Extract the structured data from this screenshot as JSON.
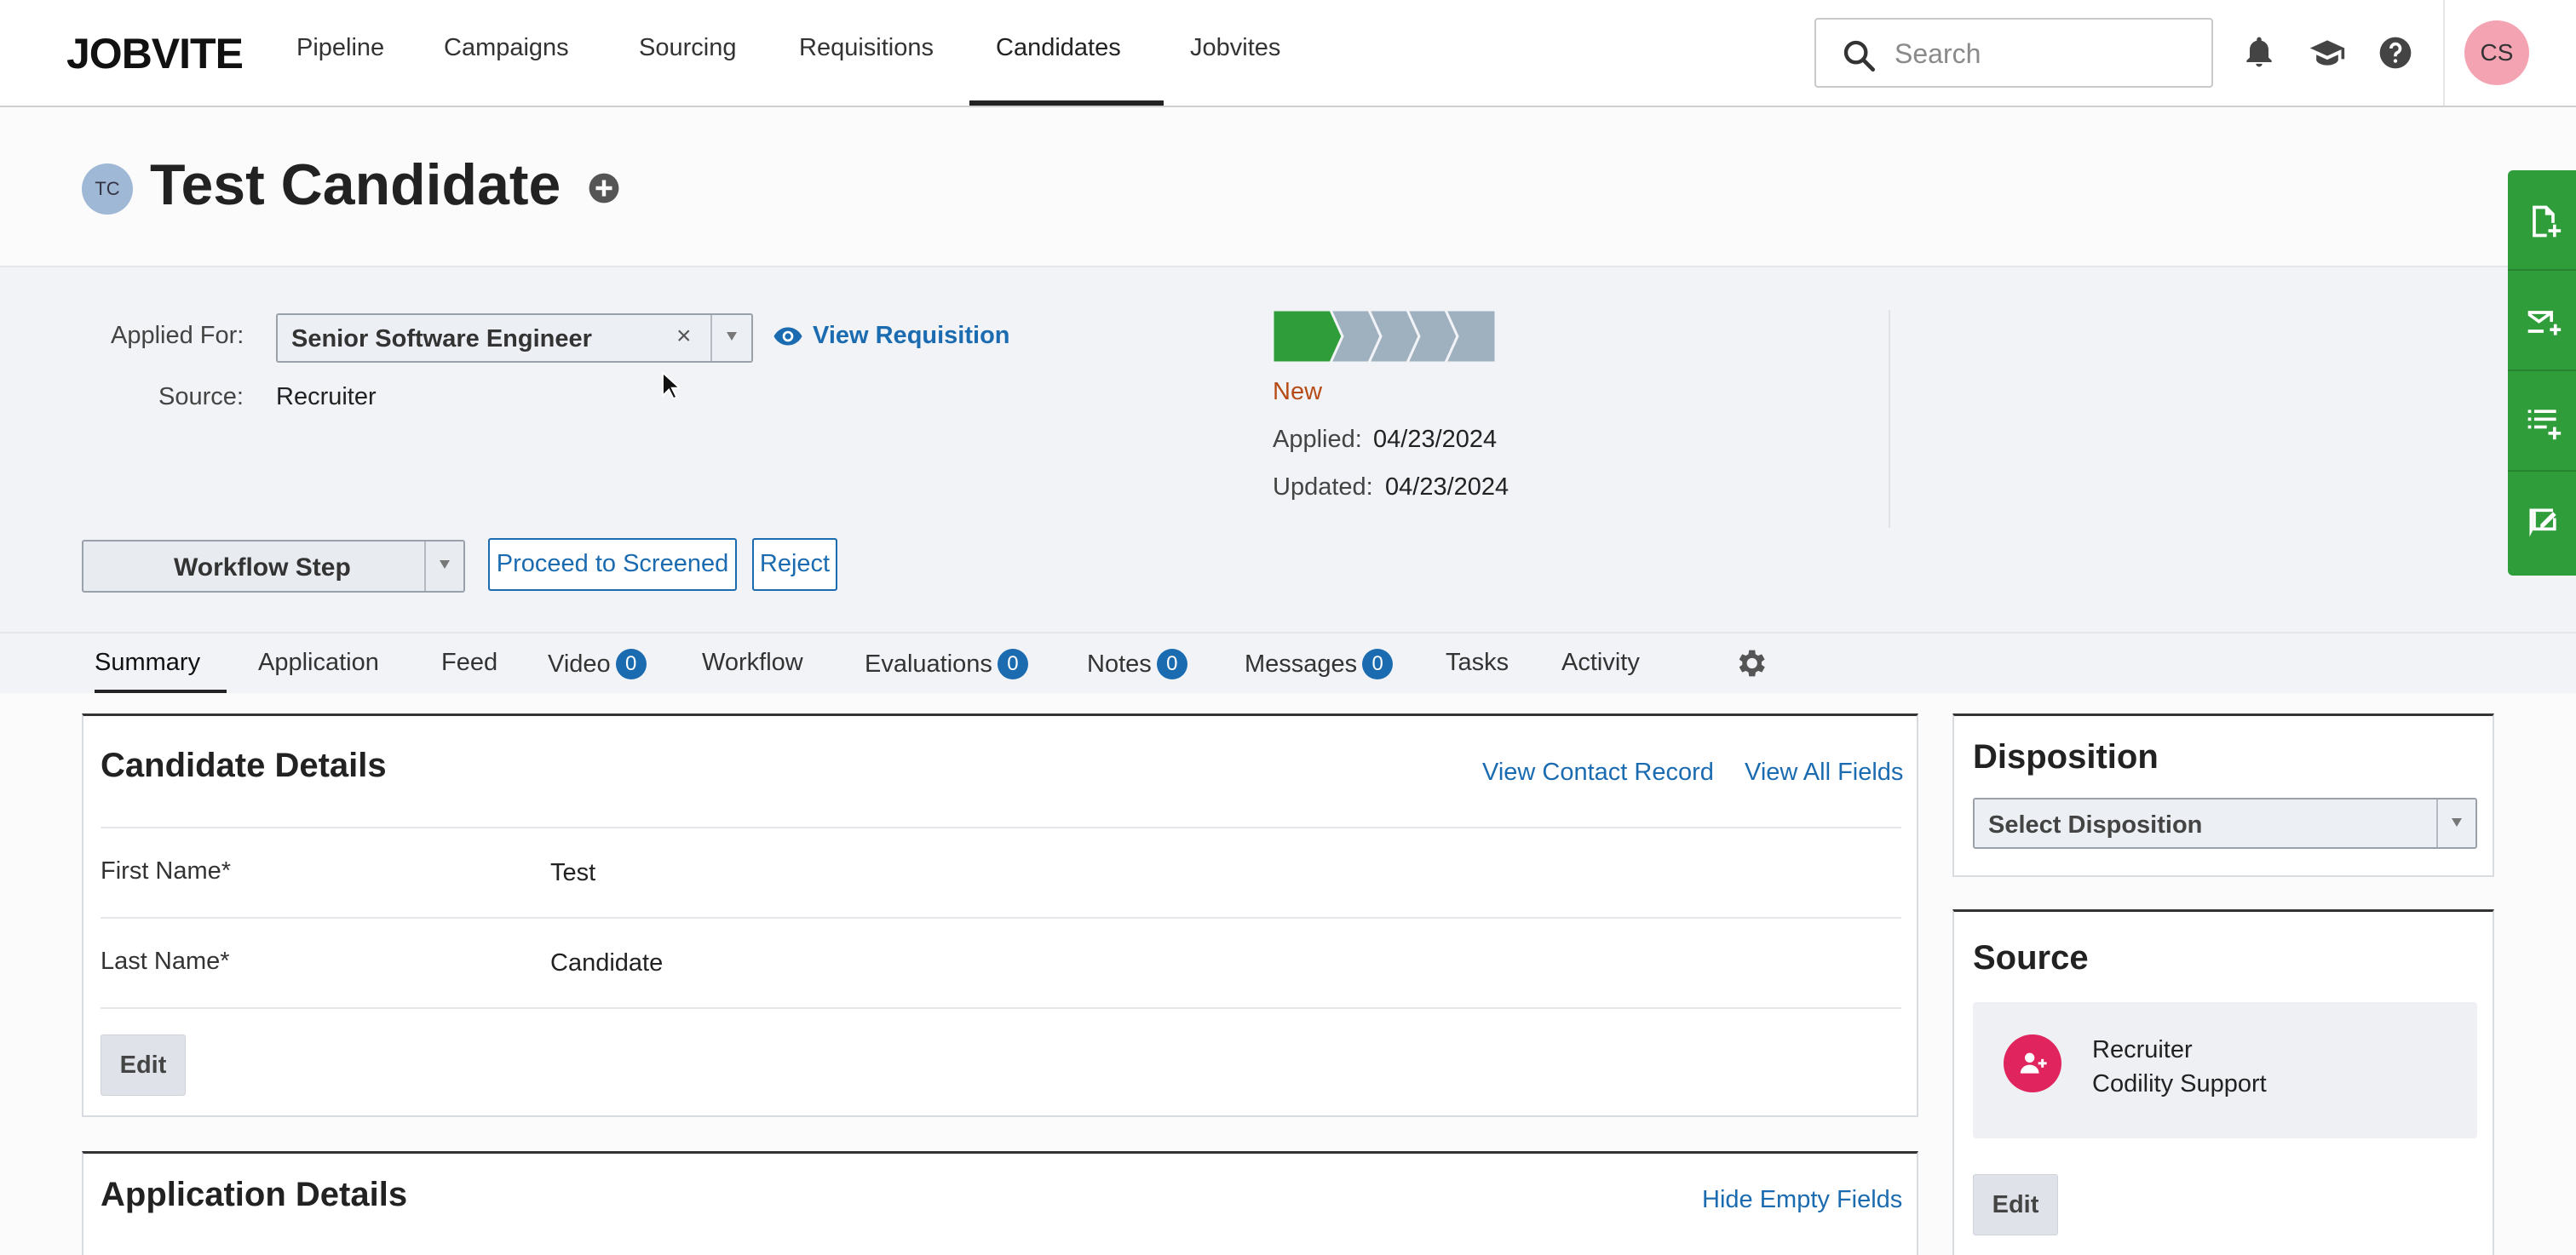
{
  "nav": {
    "logo": "JOBVITE",
    "items": [
      "Pipeline",
      "Campaigns",
      "Sourcing",
      "Requisitions",
      "Candidates",
      "Jobvites"
    ],
    "active": "Candidates",
    "search_placeholder": "Search",
    "user_initials": "CS"
  },
  "candidate": {
    "initials": "TC",
    "name": "Test Candidate"
  },
  "info": {
    "applied_for_label": "Applied For:",
    "applied_for_value": "Senior Software Engineer",
    "clear_symbol": "×",
    "view_requisition": "View Requisition",
    "source_label": "Source:",
    "source_value": "Recruiter",
    "status": "New",
    "status_color": "#b64b15",
    "progress_steps_total": 5,
    "progress_steps_done": 1,
    "applied_label": "Applied:",
    "applied_date": "04/23/2024",
    "updated_label": "Updated:",
    "updated_date": "04/23/2024",
    "workflow_step": "Workflow Step",
    "proceed_button": "Proceed to Screened",
    "reject_button": "Reject"
  },
  "tabs": [
    {
      "label": "Summary"
    },
    {
      "label": "Application"
    },
    {
      "label": "Feed"
    },
    {
      "label": "Video",
      "badge": "0"
    },
    {
      "label": "Workflow"
    },
    {
      "label": "Evaluations",
      "badge": "0"
    },
    {
      "label": "Notes",
      "badge": "0"
    },
    {
      "label": "Messages",
      "badge": "0"
    },
    {
      "label": "Tasks"
    },
    {
      "label": "Activity"
    }
  ],
  "candidate_details": {
    "title": "Candidate Details",
    "view_contact_record": "View Contact Record",
    "view_all_fields": "View All Fields",
    "fields": [
      {
        "label": "First Name",
        "required": "*",
        "value": "Test"
      },
      {
        "label": "Last Name",
        "required": "*",
        "value": "Candidate"
      }
    ],
    "edit": "Edit"
  },
  "application_details": {
    "title": "Application Details",
    "hide_empty_fields": "Hide Empty Fields"
  },
  "disposition": {
    "title": "Disposition",
    "select_placeholder": "Select Disposition"
  },
  "source_card": {
    "title": "Source",
    "type": "Recruiter",
    "name": "Codility Support",
    "edit": "Edit"
  },
  "colors": {
    "brand_link": "#1b6bb0",
    "rail_green": "#2f9e3a",
    "progress_done": "#2f9e3a",
    "progress_todo": "#9fb0bf"
  }
}
